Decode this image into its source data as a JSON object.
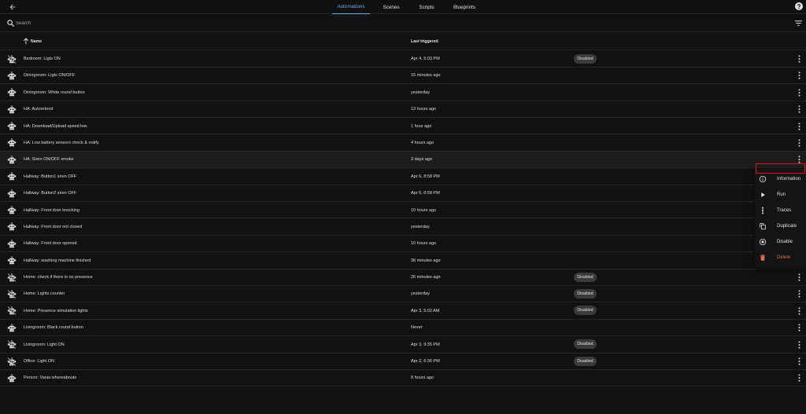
{
  "tabs": [
    {
      "label": "Automations",
      "active": true
    },
    {
      "label": "Scenes"
    },
    {
      "label": "Scripts"
    },
    {
      "label": "Blueprints"
    }
  ],
  "search": {
    "placeholder": "Search"
  },
  "columns": {
    "name": "Name",
    "last_triggered": "Last triggered"
  },
  "rows": [
    {
      "name": "Bedroom: Ligts ON",
      "time": "Apr 4, 5:03 PM",
      "badge": "Disabled",
      "disabled": true
    },
    {
      "name": "Diningroom: Ligts ON/OFF",
      "time": "15 minutes ago"
    },
    {
      "name": "Diningroom: White round button",
      "time": "yesterday"
    },
    {
      "name": "HA: Autoreboot",
      "time": "13 hours ago"
    },
    {
      "name": "HA: Download/Upload speed low.",
      "time": "1 hour ago"
    },
    {
      "name": "HA: Low battery sensors check & notify",
      "time": "4 hours ago"
    },
    {
      "name": "HA: Siren ON/OFF smoke",
      "time": "3 days ago",
      "highlighted": true
    },
    {
      "name": "Hallway: Button1 siren OFF",
      "time": "Apr 6, 8:58 PM"
    },
    {
      "name": "Hallway: Button2 siren OFF",
      "time": "Apr 6, 8:58 PM"
    },
    {
      "name": "Hallway: Front door knocking",
      "time": "10 hours ago"
    },
    {
      "name": "Hallway: Front door not closed",
      "time": "yesterday"
    },
    {
      "name": "Hallway: Front door opened",
      "time": "10 hours ago"
    },
    {
      "name": "Hallway: washing machine finished",
      "time": "36 minutes ago"
    },
    {
      "name": "Home: check if there is no presence",
      "time": "26 minutes ago",
      "badge": "Disabled",
      "disabled": true
    },
    {
      "name": "Home: Lights counter",
      "time": "yesterday",
      "badge": "Disabled",
      "disabled": true
    },
    {
      "name": "Home: Presence simulation lights",
      "time": "Apr 3, 5:02 AM",
      "badge": "Disabled",
      "disabled": true
    },
    {
      "name": "Livingroom: Black round button",
      "time": "Never"
    },
    {
      "name": "Livingroom: Light ON",
      "time": "Apr 3, 9:35 PM",
      "badge": "Disabled",
      "disabled": true
    },
    {
      "name": "Office: Light ON",
      "time": "Apr 2, 6:36 PM",
      "badge": "Disabled",
      "disabled": true
    },
    {
      "name": "Person: Vania whereabouts",
      "time": "8 hours ago"
    }
  ],
  "context_menu": [
    {
      "label": "Information",
      "icon": "info-icon"
    },
    {
      "label": "Run",
      "icon": "play-icon"
    },
    {
      "label": "Traces",
      "icon": "traces-icon"
    },
    {
      "label": "Duplicate",
      "icon": "duplicate-icon"
    },
    {
      "label": "Disable",
      "icon": "disable-icon"
    },
    {
      "label": "Delete",
      "icon": "delete-icon",
      "danger": true
    }
  ],
  "colors": {
    "background": "#111111",
    "accent": "#6fa9e8",
    "danger": "#e06a5a",
    "highlight_box": "#e3131e"
  }
}
